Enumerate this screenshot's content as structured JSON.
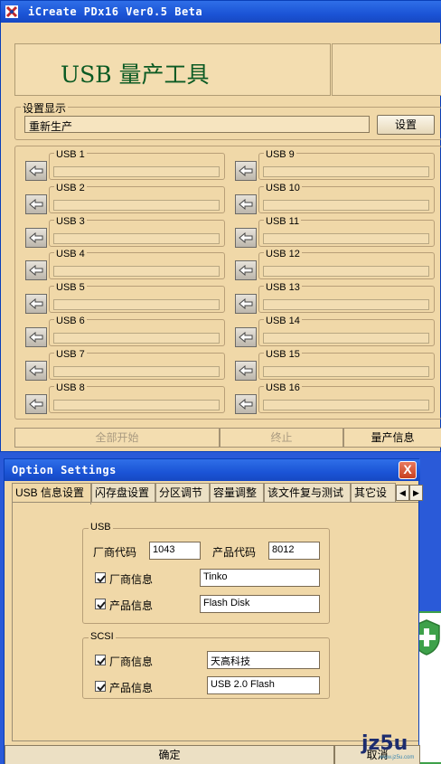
{
  "main_window": {
    "title": "iCreate PDx16 Ver0.5 Beta",
    "header_title": "USB 量产工具",
    "settings_group_label": "设置显示",
    "settings_value": "重新生产",
    "settings_button": "设置",
    "ports": [
      {
        "label": "USB 1"
      },
      {
        "label": "USB 2"
      },
      {
        "label": "USB 3"
      },
      {
        "label": "USB 4"
      },
      {
        "label": "USB 5"
      },
      {
        "label": "USB 6"
      },
      {
        "label": "USB 7"
      },
      {
        "label": "USB 8"
      },
      {
        "label": "USB 9"
      },
      {
        "label": "USB 10"
      },
      {
        "label": "USB 11"
      },
      {
        "label": "USB 12"
      },
      {
        "label": "USB 13"
      },
      {
        "label": "USB 14"
      },
      {
        "label": "USB 15"
      },
      {
        "label": "USB 16"
      }
    ],
    "start_all_button": "全部开始",
    "stop_button": "终止",
    "production_info_button": "量产信息"
  },
  "options_window": {
    "title": "Option Settings",
    "close_glyph": "X",
    "tabs": [
      {
        "label": "USB 信息设置",
        "active": true
      },
      {
        "label": "闪存盘设置",
        "active": false
      },
      {
        "label": "分区调节",
        "active": false
      },
      {
        "label": "容量调整",
        "active": false
      },
      {
        "label": "该文件复与测试",
        "active": false
      },
      {
        "label": "其它设",
        "active": false
      }
    ],
    "tab_scroll_left": "◀",
    "tab_scroll_right": "▶",
    "usb_group": {
      "label": "USB",
      "vendor_code_label": "厂商代码",
      "vendor_code": "1043",
      "product_code_label": "产品代码",
      "product_code": "8012",
      "vendor_info_label": "厂商信息",
      "vendor_info_checked": true,
      "vendor_info": "Tinko",
      "product_info_label": "产品信息",
      "product_info_checked": true,
      "product_info": "Flash Disk"
    },
    "scsi_group": {
      "label": "SCSI",
      "vendor_info_label": "厂商信息",
      "vendor_info_checked": true,
      "vendor_info": "天高科技",
      "product_info_label": "产品信息",
      "product_info_checked": true,
      "product_info": "USB 2.0 Flash"
    },
    "ok_button": "确定",
    "cancel_button": "取消"
  },
  "watermark": {
    "text": "jz5u",
    "sub": "www.jz5u.com"
  },
  "colors": {
    "titlebar": "#1b54d6",
    "window_bg": "#f0d8a8",
    "header_text": "#0b5a23",
    "shield_green": "#3ea14a"
  }
}
